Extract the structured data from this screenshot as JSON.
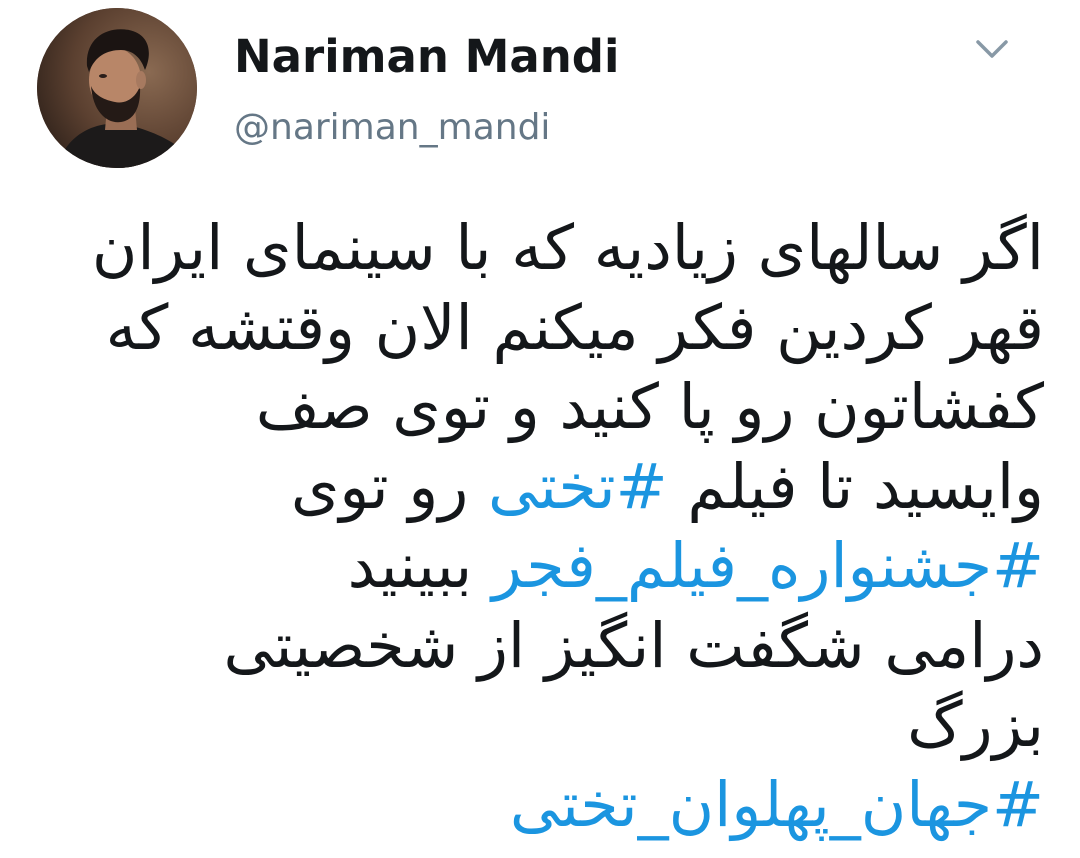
{
  "tweet": {
    "author": {
      "display_name": "Nariman Mandi",
      "handle": "@nariman_mandi",
      "avatar_icon": "profile-photo"
    },
    "menu_icon": "chevron-down-icon",
    "colors": {
      "text": "#14171a",
      "handle": "#657786",
      "hashtag": "#1b95e0",
      "chevron": "#8899a6"
    },
    "text_lines": [
      {
        "segments": [
          {
            "text": "اگر سالهای زیادیه که با سینمای ایران",
            "hashtag": false
          }
        ]
      },
      {
        "segments": [
          {
            "text": "قهر کردین فکر میکنم الان وقتشه که",
            "hashtag": false
          }
        ]
      },
      {
        "segments": [
          {
            "text": "کفشاتون رو پا کنید و توی صف",
            "hashtag": false
          }
        ]
      },
      {
        "segments": [
          {
            "text": "وایسید تا فیلم ",
            "hashtag": false
          },
          {
            "text": "#تختی",
            "hashtag": true
          },
          {
            "text": " رو توی",
            "hashtag": false
          }
        ]
      },
      {
        "segments": [
          {
            "text": "#جشنواره_فیلم_فجر",
            "hashtag": true
          },
          {
            "text": " ببینید",
            "hashtag": false
          }
        ]
      },
      {
        "segments": [
          {
            "text": "درامی شگفت انگیز از شخصیتی",
            "hashtag": false
          }
        ]
      },
      {
        "segments": [
          {
            "text": "بزرگ",
            "hashtag": false
          }
        ]
      },
      {
        "segments": [
          {
            "text": "#جهان_پهلوان_تختی",
            "hashtag": true
          }
        ]
      }
    ]
  }
}
